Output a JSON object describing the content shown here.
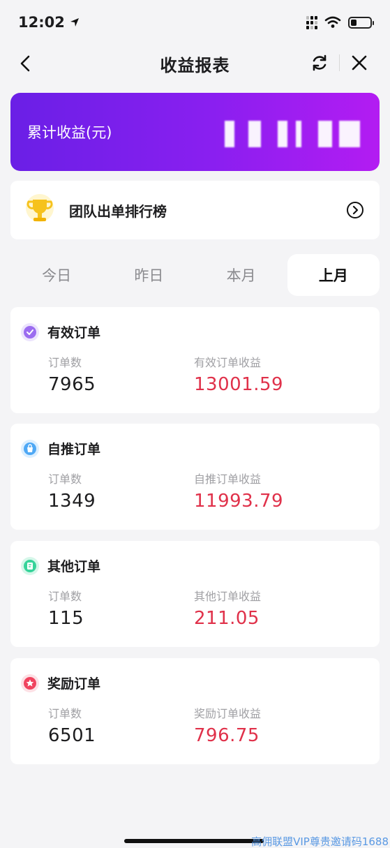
{
  "status_bar": {
    "time": "12:02"
  },
  "nav": {
    "title": "收益报表"
  },
  "banner": {
    "label": "累计收益(元)"
  },
  "rank": {
    "label": "团队出单排行榜"
  },
  "tabs": [
    {
      "label": "今日",
      "active": false
    },
    {
      "label": "昨日",
      "active": false
    },
    {
      "label": "本月",
      "active": false
    },
    {
      "label": "上月",
      "active": true
    }
  ],
  "cards": [
    {
      "title": "有效订单",
      "icon": "check-badge-icon",
      "icon_color": "#9b6cf0",
      "count_label": "订单数",
      "count": "7965",
      "income_label": "有效订单收益",
      "income": "13001.59"
    },
    {
      "title": "自推订单",
      "icon": "shopping-bag-icon",
      "icon_color": "#4ea8f5",
      "count_label": "订单数",
      "count": "1349",
      "income_label": "自推订单收益",
      "income": "11993.79"
    },
    {
      "title": "其他订单",
      "icon": "document-icon",
      "icon_color": "#36d39a",
      "count_label": "订单数",
      "count": "115",
      "income_label": "其他订单收益",
      "income": "211.05"
    },
    {
      "title": "奖励订单",
      "icon": "star-icon",
      "icon_color": "#f0435e",
      "count_label": "订单数",
      "count": "6501",
      "income_label": "奖励订单收益",
      "income": "796.75"
    }
  ],
  "watermark": "高佣联盟VIP尊贵邀请码1688",
  "colors": {
    "accent_start": "#6a1fe6",
    "accent_end": "#b31cf2",
    "income_red": "#e0314a"
  }
}
